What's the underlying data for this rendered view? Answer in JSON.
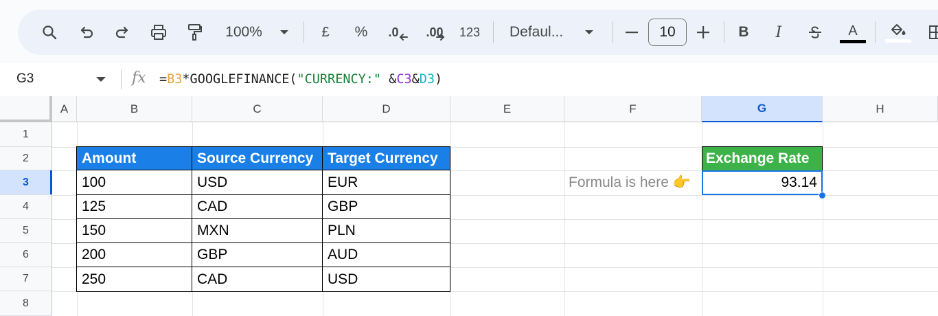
{
  "toolbar": {
    "zoom": "100%",
    "currency_symbol": "£",
    "percent_symbol": "%",
    "decrease_decimal": ".0",
    "increase_decimal": ".00",
    "number_format": "123",
    "font_name": "Defaul...",
    "font_size": "10",
    "bold": "B",
    "italic": "I",
    "text_color_letter": "A",
    "icons": [
      "search-icon",
      "undo-icon",
      "redo-icon",
      "print-icon",
      "paint-format-icon",
      "chevron-down-icon",
      "minus-icon",
      "plus-icon",
      "strikethrough-icon",
      "fill-color-icon",
      "borders-icon"
    ]
  },
  "formula_bar": {
    "name_box": "G3",
    "fx": "fx",
    "formula_parts": [
      {
        "text": "=",
        "color": "#1f1f1f"
      },
      {
        "text": "B3",
        "color": "#e8a33b"
      },
      {
        "text": "*GOOGLEFINANCE(",
        "color": "#1f1f1f"
      },
      {
        "text": "\"CURRENCY:\"",
        "color": "#188038"
      },
      {
        "text": " &",
        "color": "#1f1f1f"
      },
      {
        "text": "C3",
        "color": "#9334e6"
      },
      {
        "text": "&",
        "color": "#1f1f1f"
      },
      {
        "text": "D3",
        "color": "#12b5cb"
      },
      {
        "text": ")",
        "color": "#1f1f1f"
      }
    ]
  },
  "grid": {
    "columns": [
      "A",
      "B",
      "C",
      "D",
      "E",
      "F",
      "G",
      "H"
    ],
    "selected_column": "G",
    "rows": [
      "1",
      "2",
      "3",
      "4",
      "5",
      "6",
      "7",
      "8"
    ],
    "selected_row": "3",
    "table": {
      "headers": [
        "Amount",
        "Source Currency",
        "Target Currency"
      ],
      "rows": [
        [
          "100",
          "USD",
          "EUR"
        ],
        [
          "125",
          "CAD",
          "GBP"
        ],
        [
          "150",
          "MXN",
          "PLN"
        ],
        [
          "200",
          "GBP",
          "AUD"
        ],
        [
          "250",
          "CAD",
          "USD"
        ]
      ]
    },
    "note": "Formula is here 👉",
    "result_header": "Exchange Rate",
    "result_value": "93.14"
  },
  "colors": {
    "header_blue": "#1a80e8",
    "header_green": "#3db249",
    "selection_blue": "#1a73e8"
  }
}
